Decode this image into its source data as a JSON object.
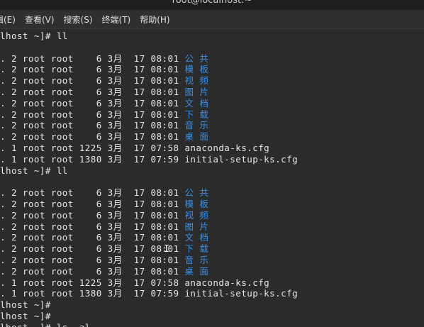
{
  "window": {
    "title": "root@localhost:~"
  },
  "menubar": {
    "items": [
      "辑(E)",
      "查看(V)",
      "搜索(S)",
      "终端(T)",
      "帮助(H)"
    ]
  },
  "terminal": {
    "lines": [
      {
        "text": "lhost ~]# ll"
      },
      {
        "text": ""
      },
      {
        "text": ". 2 root root    6 3月  17 08:01 ",
        "name": "公共",
        "dir": true
      },
      {
        "text": ". 2 root root    6 3月  17 08:01 ",
        "name": "模板",
        "dir": true
      },
      {
        "text": ". 2 root root    6 3月  17 08:01 ",
        "name": "视频",
        "dir": true
      },
      {
        "text": ". 2 root root    6 3月  17 08:01 ",
        "name": "图片",
        "dir": true
      },
      {
        "text": ". 2 root root    6 3月  17 08:01 ",
        "name": "文档",
        "dir": true
      },
      {
        "text": ". 2 root root    6 3月  17 08:01 ",
        "name": "下载",
        "dir": true
      },
      {
        "text": ". 2 root root    6 3月  17 08:01 ",
        "name": "音乐",
        "dir": true
      },
      {
        "text": ". 2 root root    6 3月  17 08:01 ",
        "name": "桌面",
        "dir": true
      },
      {
        "text": ". 1 root root 1225 3月  17 07:58 anaconda-ks.cfg"
      },
      {
        "text": ". 1 root root 1380 3月  17 07:59 initial-setup-ks.cfg"
      },
      {
        "text": "lhost ~]# ll"
      },
      {
        "text": ""
      },
      {
        "text": ". 2 root root    6 3月  17 08:01 ",
        "name": "公共",
        "dir": true
      },
      {
        "text": ". 2 root root    6 3月  17 08:01 ",
        "name": "模板",
        "dir": true
      },
      {
        "text": ". 2 root root    6 3月  17 08:01 ",
        "name": "视频",
        "dir": true
      },
      {
        "text": ". 2 root root    6 3月  17 08:01 ",
        "name": "图片",
        "dir": true
      },
      {
        "text": ". 2 root root    6 3月  17 08:01 ",
        "name": "文档",
        "dir": true
      },
      {
        "text": ". 2 root root    6 3月  17 08:01 ",
        "name": "下载",
        "dir": true
      },
      {
        "text": ". 2 root root    6 3月  17 08:01 ",
        "name": "音乐",
        "dir": true
      },
      {
        "text": ". 2 root root    6 3月  17 08:01 ",
        "name": "桌面",
        "dir": true
      },
      {
        "text": ". 1 root root 1225 3月  17 07:58 anaconda-ks.cfg"
      },
      {
        "text": ". 1 root root 1380 3月  17 07:59 initial-setup-ks.cfg"
      },
      {
        "text": "lhost ~]#"
      },
      {
        "text": "lhost ~]#"
      },
      {
        "text": "lhost ~]# ls -al"
      }
    ]
  },
  "colors": {
    "background": "#2b2b2b",
    "text": "#e6e6e6",
    "directory": "#3a8ee6"
  }
}
